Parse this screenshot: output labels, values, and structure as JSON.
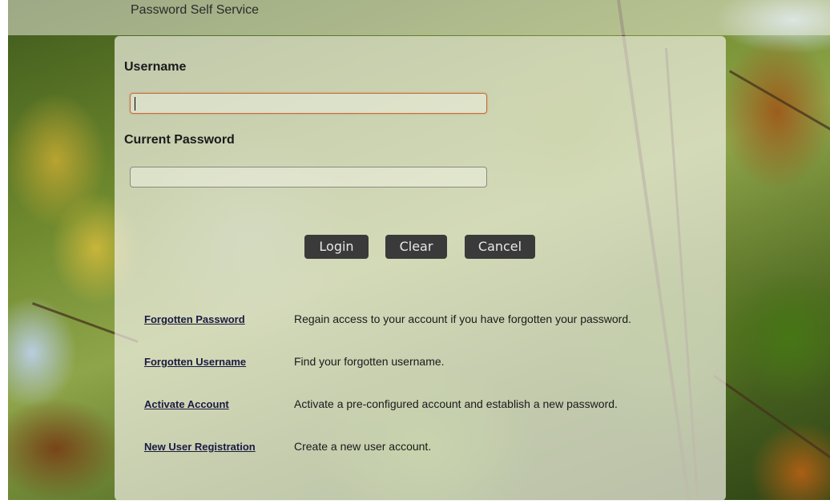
{
  "header": {
    "title": "Password Self Service"
  },
  "login_form": {
    "username_label": "Username",
    "username_value": "",
    "password_label": "Current Password",
    "password_value": ""
  },
  "buttons": {
    "login": "Login",
    "clear": "Clear",
    "cancel": "Cancel"
  },
  "links": [
    {
      "label": "Forgotten Password",
      "description": "Regain access to your account if you have forgotten your password."
    },
    {
      "label": "Forgotten Username",
      "description": "Find your forgotten username."
    },
    {
      "label": "Activate Account",
      "description": "Activate a pre-configured account and establish a new password."
    },
    {
      "label": "New User Registration",
      "description": "Create a new user account."
    }
  ],
  "colors": {
    "button_bg": "#3a3a3a",
    "focused_field_border": "#c86a3a"
  }
}
